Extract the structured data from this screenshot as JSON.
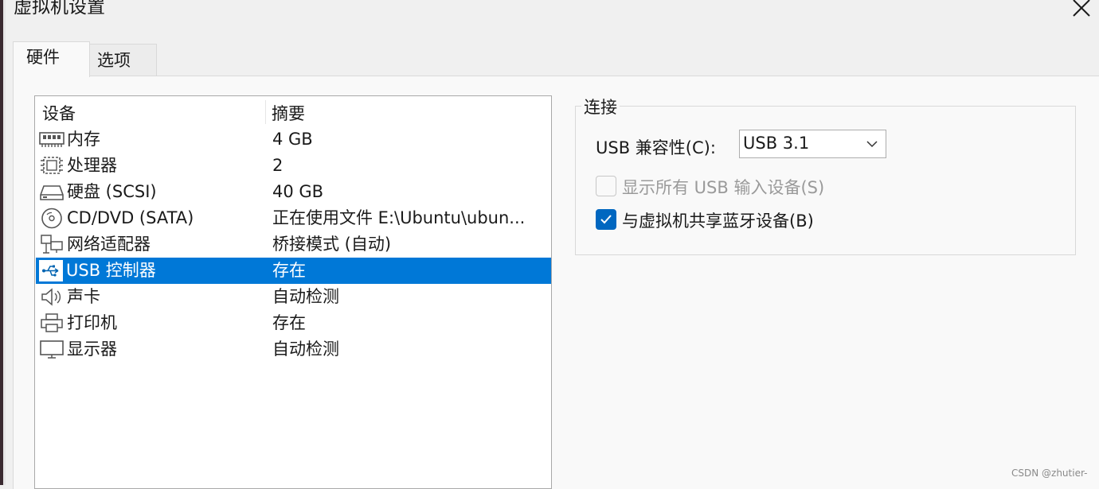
{
  "window": {
    "title": "虚拟机设置"
  },
  "tabs": [
    {
      "label": "硬件",
      "active": true
    },
    {
      "label": "选项",
      "active": false
    }
  ],
  "device_list": {
    "columns": [
      "设备",
      "摘要"
    ],
    "rows": [
      {
        "name": "内存",
        "summary": "4 GB",
        "icon": "memory-icon"
      },
      {
        "name": "处理器",
        "summary": "2",
        "icon": "processor-icon"
      },
      {
        "name": "硬盘 (SCSI)",
        "summary": "40 GB",
        "icon": "hard-disk-icon"
      },
      {
        "name": "CD/DVD (SATA)",
        "summary": "正在使用文件 E:\\Ubuntu\\ubun...",
        "icon": "cd-dvd-icon"
      },
      {
        "name": "网络适配器",
        "summary": "桥接模式 (自动)",
        "icon": "network-adapter-icon"
      },
      {
        "name": "USB 控制器",
        "summary": "存在",
        "icon": "usb-icon",
        "selected": true
      },
      {
        "name": "声卡",
        "summary": "自动检测",
        "icon": "speaker-icon"
      },
      {
        "name": "打印机",
        "summary": "存在",
        "icon": "printer-icon"
      },
      {
        "name": "显示器",
        "summary": "自动检测",
        "icon": "monitor-icon"
      }
    ]
  },
  "connection": {
    "group_title": "连接",
    "usb_compat_label": "USB 兼容性(C):",
    "usb_compat_value": "USB 3.1",
    "show_all_usb": {
      "label": "显示所有 USB 输入设备(S)",
      "checked": false,
      "enabled": false
    },
    "share_bluetooth": {
      "label": "与虚拟机共享蓝牙设备(B)",
      "checked": true,
      "enabled": true
    }
  },
  "watermark": "CSDN @zhutier-",
  "colors": {
    "selection": "#0078d7",
    "checkbox_accent": "#0067c0"
  }
}
